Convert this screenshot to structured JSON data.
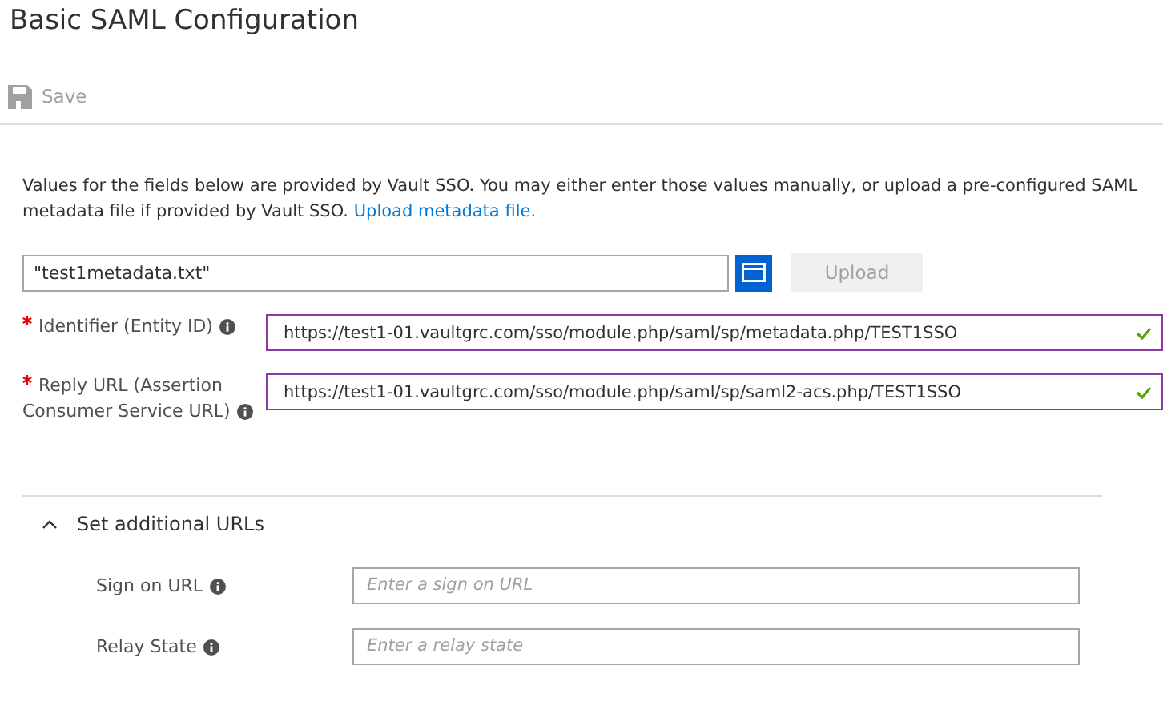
{
  "title": "Basic SAML Configuration",
  "toolbar": {
    "save": {
      "label": "Save",
      "disabled": true
    }
  },
  "intro": {
    "text": "Values for the fields below are provided by Vault SSO. You may either enter those values manually, or upload a pre-configured SAML metadata file if provided by Vault SSO.",
    "link": "Upload metadata file."
  },
  "file_upload": {
    "value": "\"test1metadata.txt\"",
    "upload_label": "Upload",
    "upload_disabled": true
  },
  "fields": [
    {
      "label": "Identifier (Entity ID)",
      "required": true,
      "value": "https://test1-01.vaultgrc.com/sso/module.php/saml/sp/metadata.php/TEST1SSO",
      "valid": true
    },
    {
      "label": "Reply URL (Assertion Consumer Service URL)",
      "required": true,
      "value": "https://test1-01.vaultgrc.com/sso/module.php/saml/sp/saml2-acs.php/TEST1SSO",
      "valid": true
    }
  ],
  "additional": {
    "label": "Set additional URLs",
    "expanded": true,
    "fields": [
      {
        "label": "Sign on URL",
        "placeholder": "Enter a sign on URL"
      },
      {
        "label": "Relay State",
        "placeholder": "Enter a relay state"
      }
    ]
  }
}
